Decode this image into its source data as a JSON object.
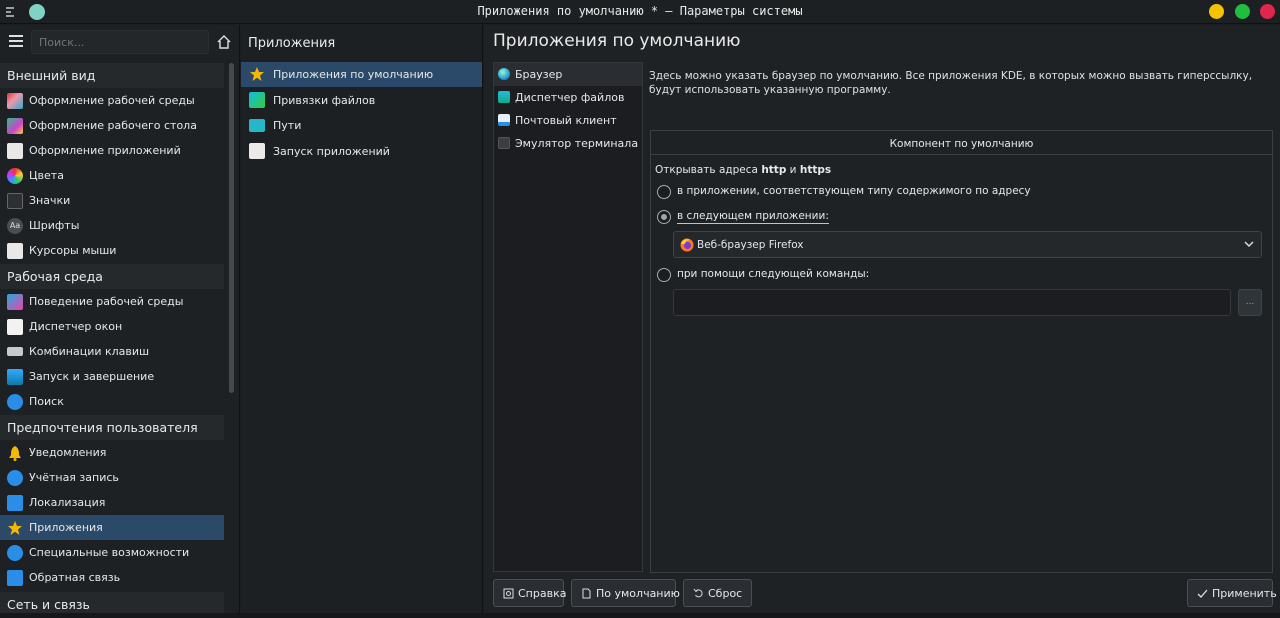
{
  "window": {
    "title": "Приложения по умолчанию * — Параметры системы",
    "colors": {
      "minimize": "#f5c400",
      "maximize": "#1fbf3d",
      "close": "#e0264d",
      "accent": "#2b4a6a"
    }
  },
  "sidebar": {
    "search_placeholder": "Поиск...",
    "categories": [
      {
        "label": "Внешний вид",
        "items": [
          {
            "label": "Оформление рабочей среды",
            "icon": "plasma-theme-icon"
          },
          {
            "label": "Оформление рабочего стола",
            "icon": "desktop-theme-icon"
          },
          {
            "label": "Оформление приложений",
            "icon": "app-style-icon"
          },
          {
            "label": "Цвета",
            "icon": "colors-icon"
          },
          {
            "label": "Значки",
            "icon": "icons-icon"
          },
          {
            "label": "Шрифты",
            "icon": "fonts-icon"
          },
          {
            "label": "Курсоры мыши",
            "icon": "cursor-icon"
          }
        ]
      },
      {
        "label": "Рабочая среда",
        "items": [
          {
            "label": "Поведение рабочей среды",
            "icon": "workspace-behavior-icon"
          },
          {
            "label": "Диспетчер окон",
            "icon": "window-manager-icon"
          },
          {
            "label": "Комбинации клавиш",
            "icon": "keyboard-icon"
          },
          {
            "label": "Запуск и завершение",
            "icon": "startup-icon"
          },
          {
            "label": "Поиск",
            "icon": "search-icon"
          }
        ]
      },
      {
        "label": "Предпочтения пользователя",
        "items": [
          {
            "label": "Уведомления",
            "icon": "bell-icon"
          },
          {
            "label": "Учётная запись",
            "icon": "user-icon"
          },
          {
            "label": "Локализация",
            "icon": "locale-icon"
          },
          {
            "label": "Приложения",
            "icon": "star-icon"
          },
          {
            "label": "Специальные возможности",
            "icon": "accessibility-icon"
          },
          {
            "label": "Обратная связь",
            "icon": "feedback-icon"
          }
        ]
      },
      {
        "label": "Сеть и связь",
        "items": []
      }
    ]
  },
  "middle": {
    "header": "Приложения",
    "items": [
      {
        "label": "Приложения по умолчанию",
        "icon": "star-icon"
      },
      {
        "label": "Привязки файлов",
        "icon": "file-assoc-icon"
      },
      {
        "label": "Пути",
        "icon": "folder-icon"
      },
      {
        "label": "Запуск приложений",
        "icon": "launch-icon"
      }
    ]
  },
  "main": {
    "title": "Приложения по умолчанию",
    "components": [
      {
        "label": "Браузер",
        "icon": "globe-icon"
      },
      {
        "label": "Диспетчер файлов",
        "icon": "file-manager-icon"
      },
      {
        "label": "Почтовый клиент",
        "icon": "mail-icon"
      },
      {
        "label": "Эмулятор терминала",
        "icon": "terminal-icon"
      }
    ],
    "description": "Здесь можно указать браузер по умолчанию. Все приложения KDE, в которых можно вызвать гиперссылку, будут использовать указанную программу.",
    "group": {
      "title": "Компонент по умолчанию",
      "opens_prefix": "Открывать адреса ",
      "opens_http": "http",
      "opens_and": " и ",
      "opens_https": "https",
      "option_content_type": "в приложении, соответствующем типу содержимого по адресу",
      "option_following_app": "в следующем приложении:",
      "selected_browser": "Веб-браузер Firefox",
      "option_command": "при помощи следующей команды:",
      "command_value": "",
      "browse_label": "..."
    },
    "buttons": {
      "help": "Справка",
      "defaults": "По умолчанию",
      "reset": "Сброс",
      "apply": "Применить"
    }
  }
}
